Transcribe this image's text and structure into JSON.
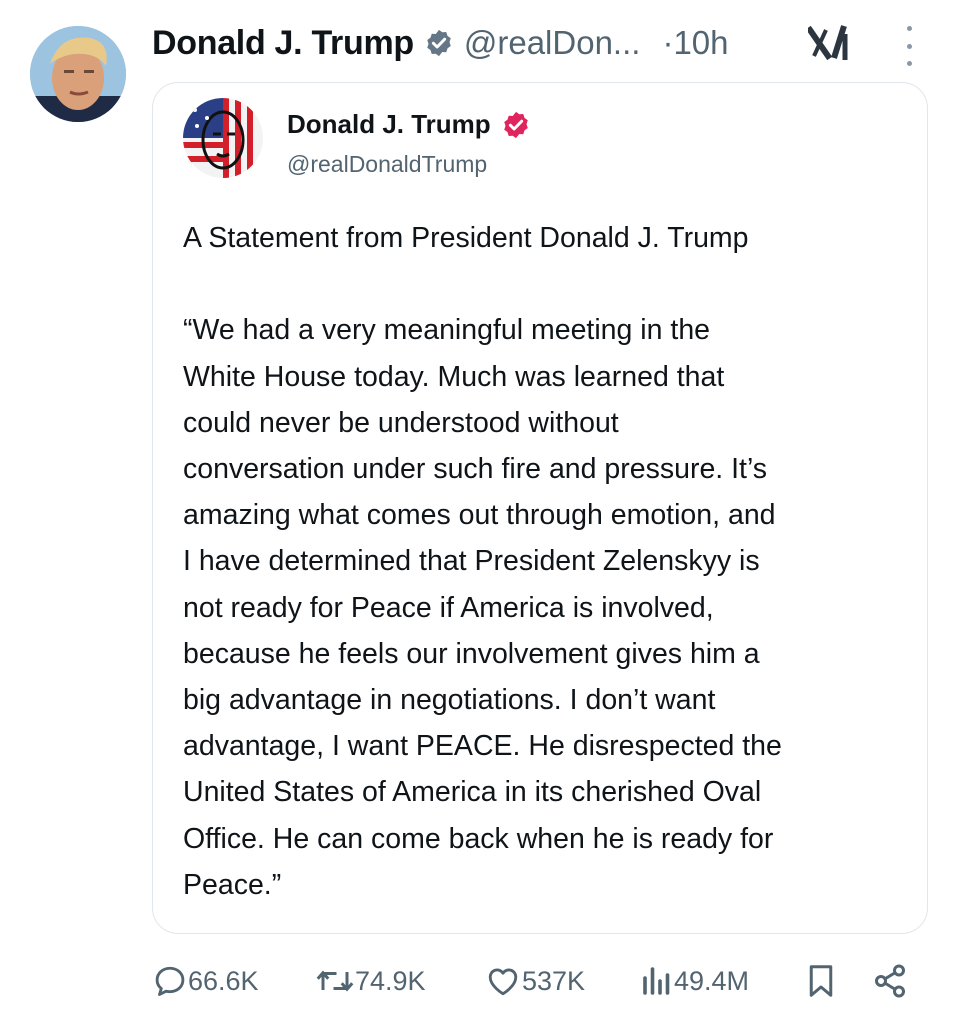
{
  "post": {
    "author_name": "Donald J. Trump",
    "author_handle": "@realDon...",
    "separator": "·",
    "time": "10h",
    "verified_color": "#657786"
  },
  "quoted": {
    "author_name": "Donald J. Trump",
    "author_handle": "@realDonaldTrump",
    "verified_color": "#e0245e",
    "text": "A Statement from President Donald J. Trump\n\n“We had a very meaningful meeting in the\nWhite House today. Much was learned that\ncould never be understood without\nconversation under such fire and pressure. It’s\namazing what comes out through emotion, and\nI have determined that President Zelenskyy is\nnot ready for Peace if America is involved,\nbecause he feels our involvement gives him a\nbig advantage in negotiations. I don’t want\nadvantage, I want PEACE. He disrespected the\nUnited States of America in its cherished Oval\nOffice. He can come back when he is ready for\nPeace.”"
  },
  "actions": {
    "replies": "66.6K",
    "reposts": "74.9K",
    "likes": "537K",
    "views": "49.4M",
    "icons": [
      "reply-icon",
      "repost-icon",
      "like-icon",
      "views-icon",
      "bookmark-icon",
      "share-icon"
    ]
  }
}
